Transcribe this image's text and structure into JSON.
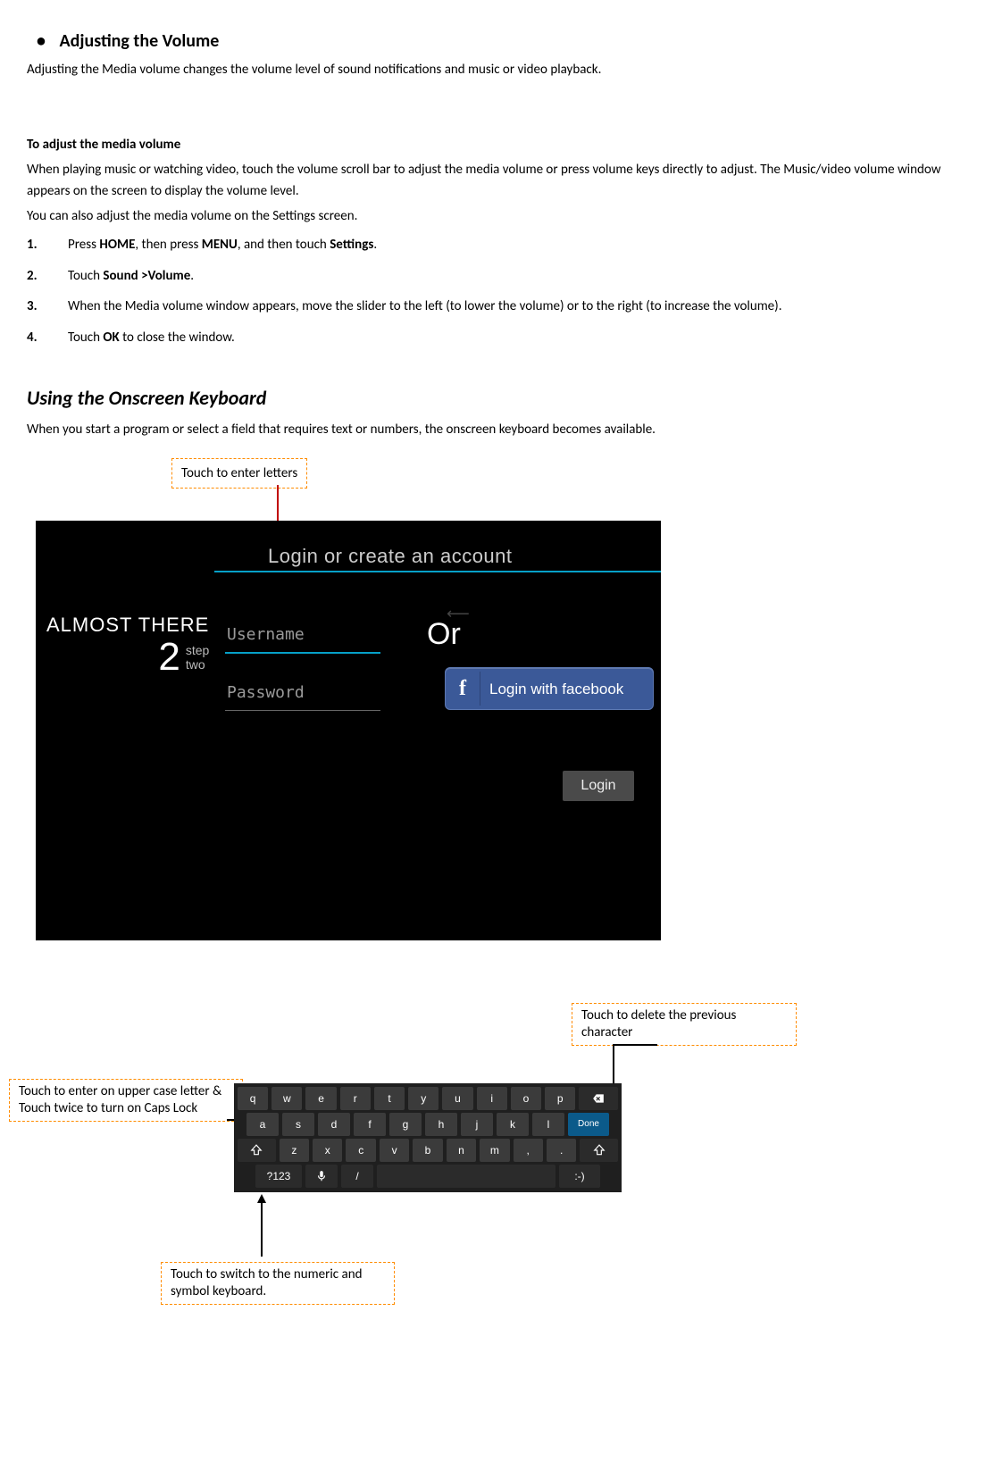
{
  "heading_bullet": "Adjusting the Volume",
  "intro_para": "Adjusting the Media volume changes the volume level of sound notifications and music or video playback.",
  "sub_heading": "To adjust the media volume",
  "sub_para1": "When playing music or watching video, touch the volume scroll bar to adjust the media volume or press volume keys directly to adjust. The Music/video volume window appears on the screen to display the volume level.",
  "sub_para2": "You can also adjust the media volume on the Settings screen.",
  "steps": [
    {
      "pre": "Press ",
      "b1": "HOME",
      "mid1": ", then press ",
      "b2": "MENU",
      "mid2": ", and then touch ",
      "b3": "Settings",
      "post": "."
    },
    {
      "pre": "Touch ",
      "b1": "Sound >Volume",
      "post": "."
    },
    {
      "pre": "When the Media volume window appears, move the slider to the left (to lower the volume) or to the right (to increase the volume)."
    },
    {
      "pre": "Touch ",
      "b1": "OK",
      "post": " to close the window."
    }
  ],
  "section2_title": "Using the Onscreen Keyboard",
  "section2_para": "When you start a program or select a field that requires text or numbers, the onscreen keyboard becomes available.",
  "callout_letters": "Touch to enter letters",
  "login": {
    "title": "Login or create an account",
    "almost": "ALMOST THERE",
    "two": "2",
    "step1": "step",
    "step2": "two",
    "username": "Username",
    "password": "Password",
    "or": "Or",
    "fb": "Login with facebook",
    "login_btn": "Login"
  },
  "callout_caps": "Touch to enter on upper case letter & Touch twice to turn on Caps Lock",
  "callout_delete": "Touch to delete the previous character",
  "callout_numeric": "Touch to switch to the numeric and symbol keyboard.",
  "kb": {
    "row1": [
      "q",
      "w",
      "e",
      "r",
      "t",
      "y",
      "u",
      "i",
      "o",
      "p"
    ],
    "row2": [
      "a",
      "s",
      "d",
      "f",
      "g",
      "h",
      "j",
      "k",
      "l"
    ],
    "row3": [
      "z",
      "x",
      "c",
      "v",
      "b",
      "n",
      "m",
      ",",
      "."
    ],
    "mode": "?123",
    "slash": "/",
    "done": "Done",
    "smile": ":-)"
  }
}
